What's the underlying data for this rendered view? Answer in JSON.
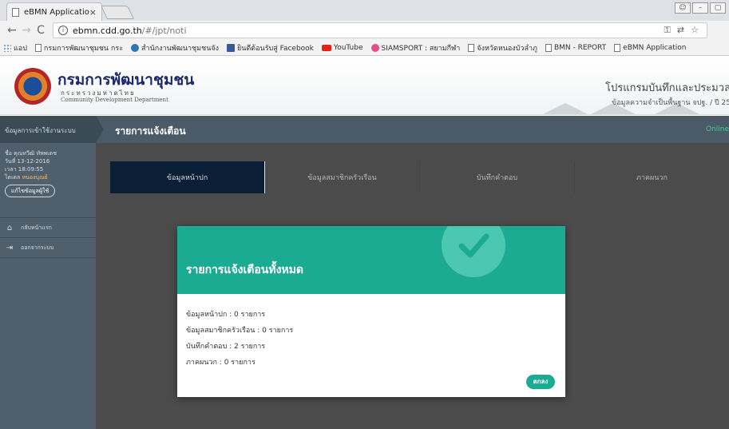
{
  "browser": {
    "tab_title": "eBMN Application",
    "tab_close": "×",
    "url_host": "ebmn.cdd.go.th",
    "url_path": "/#/jpt/noti",
    "bookmarks": [
      {
        "icon": "apps-icon",
        "label": "แอป"
      },
      {
        "icon": "page-icon",
        "label": "กรมการพัฒนาชุมชน กระ"
      },
      {
        "icon": "globe-icon",
        "label": "สำนักงานพัฒนาชุมชนจัง"
      },
      {
        "icon": "facebook-icon",
        "label": "ยินดีต้อนรับสู่ Facebook"
      },
      {
        "icon": "youtube-icon",
        "label": "YouTube"
      },
      {
        "icon": "siamsport-icon",
        "label": "SIAMSPORT : สยามกีฬา"
      },
      {
        "icon": "page-icon",
        "label": "จังหวัดหนองบัวลำภู"
      },
      {
        "icon": "page-icon",
        "label": "BMN - REPORT"
      },
      {
        "icon": "page-icon",
        "label": "eBMN Application"
      }
    ]
  },
  "header": {
    "org_name": "กรมการพัฒนาชุมชน",
    "org_sub": "กระทรวงมหาดไทย",
    "org_en": "Community Development Department",
    "app_title": "โปรแกรมบันทึกและประมวล",
    "app_subtitle": "ข้อมูลความจำเป็นพื้นฐาน จปฐ. / ปี 25"
  },
  "sidebar": {
    "heading": "ข้อมูลการเข้าใช้งานระบบ",
    "user_line1": "ชื่อ คุณทวีฒิ ทัพพเดช",
    "user_line2": "วันที่ 13-12-2016",
    "user_line3": "เวลา 18:09:55",
    "user_line4_prefix": "ไดเดล",
    "user_line4_tag": "หนองบุณย์",
    "edit_button": "แก้ไขข้อมูลผู้ใช้",
    "items": [
      {
        "icon": "home-icon",
        "label": "กลับหน้าแรก"
      },
      {
        "icon": "logout-icon",
        "label": "ออกจากระบบ"
      }
    ]
  },
  "page": {
    "title": "รายการแจ้งเตือน",
    "status": "Online",
    "tabs": [
      "ข้อมูลหน้าปก",
      "ข้อมูลสมาชิกครัวเรือน",
      "บันทึกคำตอบ",
      "ภาคผนวก"
    ]
  },
  "modal": {
    "title": "รายการแจ้งเตือนทั้งหมด",
    "lines": [
      "ข้อมูลหน้าปก : 0 รายการ",
      "ข้อมูลสมาชิกครัวเรือน : 0 รายการ",
      "บันทึกคำตอบ : 2 รายการ",
      "ภาคผนวก : 0 รายการ"
    ],
    "ok_label": "ตกลง"
  },
  "colors": {
    "accent": "#1bab93",
    "tab_active": "#0b2f57",
    "sidebar": "#4f5f6b"
  }
}
